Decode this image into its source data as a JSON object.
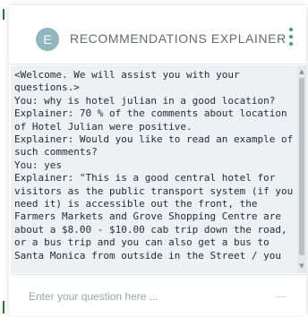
{
  "header": {
    "avatar_letter": "E",
    "title": "RECOMMENDATIONS EXPLAINER",
    "menu_icon": "vertical-ellipsis-icon",
    "accent_color": "#3aa38f",
    "avatar_color": "#8fb7bd"
  },
  "transcript": {
    "text": "<Welcome. We will assist you with your questions.>\nYou: why is hotel julian in a good location?\nExplainer: 70 % of the comments about location of Hotel Julian were positive.\nExplainer: Would you like to read an example of such comments?\nYou: yes\nExplainer: \"This is a good central hotel for visitors as the public transport system (if you need it) is accessible out the front, the Farmers Markets and Grove Shopping Centre are about a $8.00 - $10.00 cab trip down the road, or a bus trip and you can also get a bus to Santa Monica from outside in the Street / you"
  },
  "input": {
    "placeholder": "Enter your question here ...",
    "value": ""
  }
}
